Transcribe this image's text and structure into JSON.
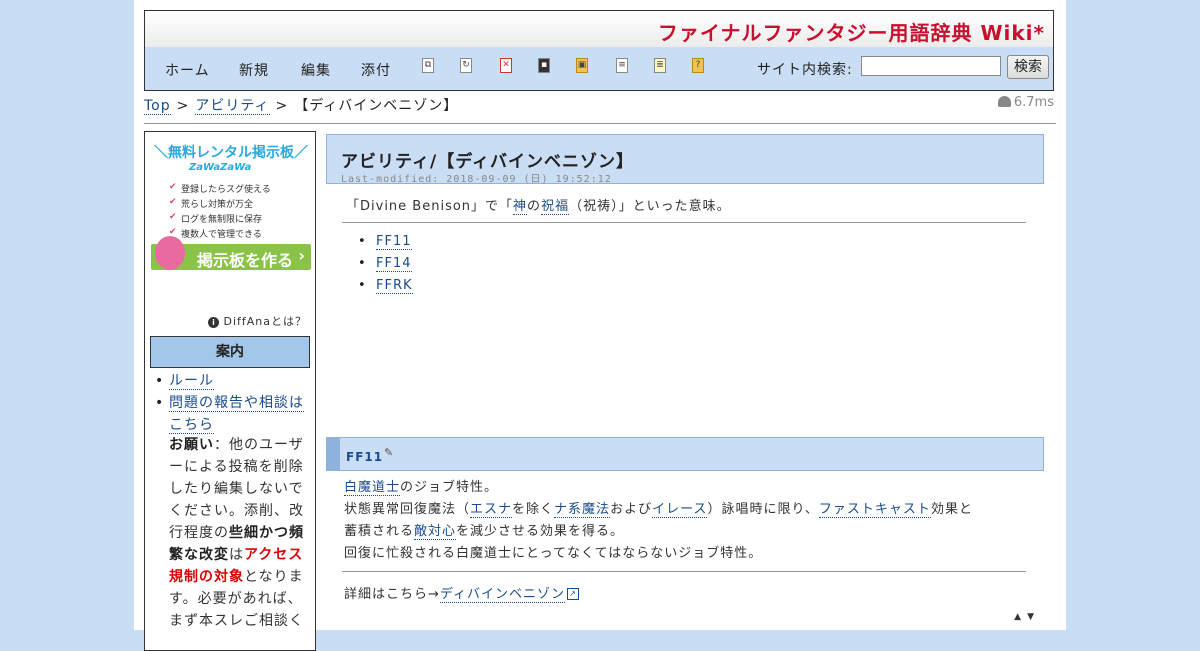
{
  "header": {
    "site_title": "ファイナルファンタジー用語辞典 Wiki*"
  },
  "nav": {
    "items": [
      "ホーム",
      "新規",
      "編集",
      "添付"
    ],
    "tool_icons": [
      "copy-page-icon",
      "rename-icon",
      "delete-icon",
      "save-icon",
      "lock-icon",
      "list-icon",
      "recent-icon",
      "help-icon"
    ],
    "search_label": "サイト内検索:",
    "search_value": "",
    "search_button": "検索"
  },
  "breadcrumb": {
    "top": "Top",
    "parent": "アビリティ",
    "current": "【ディバインベニゾン】",
    "separator": ">"
  },
  "timing": "6.7ms",
  "sidebar": {
    "ad": {
      "title": "＼無料レンタル掲示板／",
      "logo": "ZaWaZaWa",
      "features": [
        "登録したらスグ使える",
        "荒らし対策が万全",
        "ログを無制限に保存",
        "複数人で管理できる"
      ],
      "button_label": "掲示板を作る",
      "button_arrow": "›"
    },
    "diffana": "DiffAnaとは？",
    "menu_title": "案内",
    "menu_items": [
      "ルール",
      "問題の報告や相談はこちら"
    ],
    "note": {
      "lead": "お願い",
      "text1": "：他のユーザーによる投稿を削除したり編集しないでください。添削、改行程度の",
      "bold": "些細かつ頻繁な改変",
      "text2": "は",
      "red": "アクセス規制の対象",
      "text3": "となります。必要があれば、まず本スレご相談く"
    }
  },
  "main": {
    "page_title": "アビリティ/【ディバインベニゾン】",
    "last_modified": "Last-modified: 2018-09-09 (日) 19:52:12",
    "intro": {
      "before": "「Divine Benison」で「",
      "link1": "神",
      "mid1": "の",
      "link2": "祝福",
      "after": "（祝祷）」といった意味。"
    },
    "toc": [
      "FF11",
      "FF14",
      "FFRK"
    ],
    "section": {
      "title": "FF11",
      "line1": {
        "link": "白魔道士",
        "text": "のジョブ特性。"
      },
      "line2": {
        "t1": "状態異常回復魔法（",
        "l1": "エスナ",
        "t2": "を除く",
        "l2": "ナ系魔法",
        "t3": "および",
        "l3": "イレース",
        "t4": "）詠唱時に限り、",
        "l4": "ファストキャスト",
        "t5": "効果と"
      },
      "line3": {
        "t1": "蓄積される",
        "l1": "敵対心",
        "t2": "を減少させる効果を得る。"
      },
      "line4": "回復に忙殺される白魔道士にとってなくてはならないジョブ特性。",
      "detail_prefix": "詳細はこちら→",
      "detail_link": "ディバインベニゾン"
    },
    "updown": "▲▼"
  }
}
